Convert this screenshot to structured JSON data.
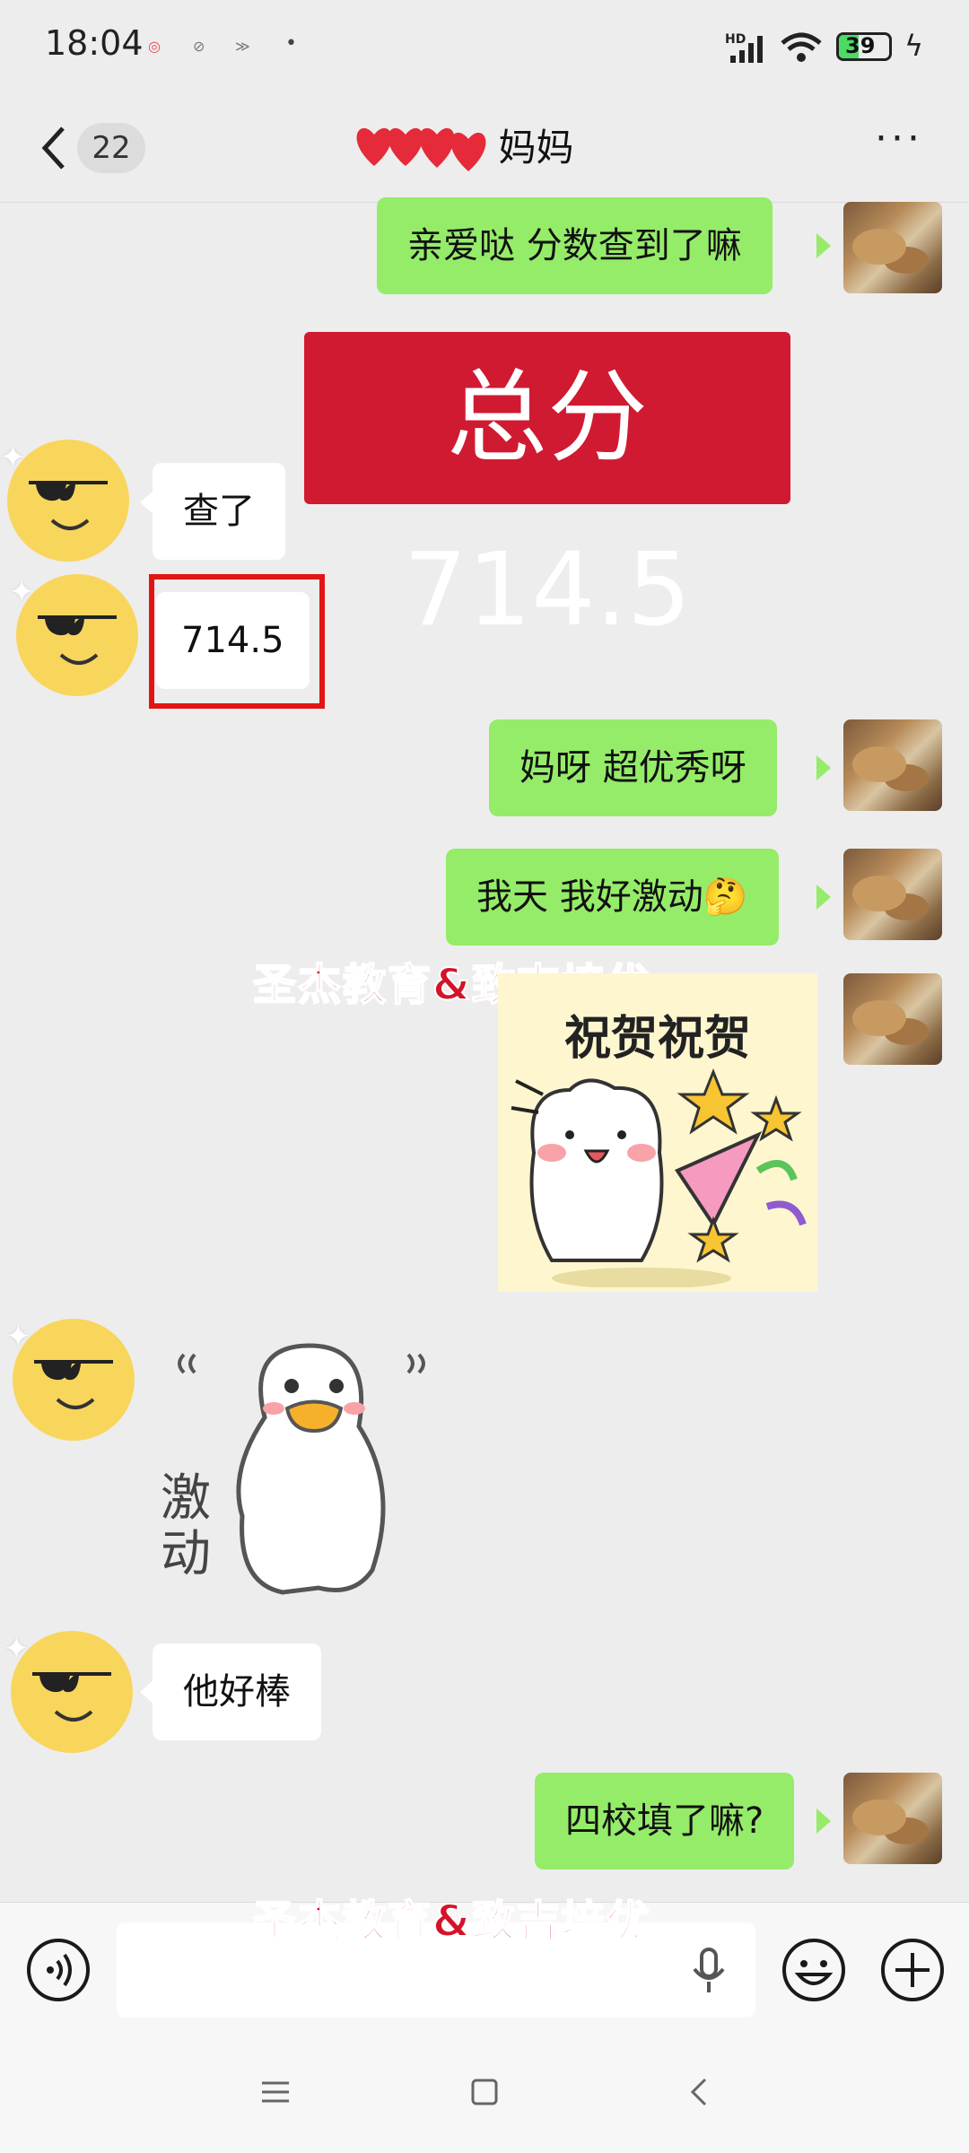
{
  "status": {
    "time": "18:04",
    "network": "HD",
    "battery": "39"
  },
  "header": {
    "back_count": "22",
    "title": "妈妈",
    "more": "···"
  },
  "messages": {
    "m1": "亲爱哒 分数查到了嘛",
    "score_card": "总分714.5",
    "m2": "查了",
    "m3": "714.5",
    "m4": "妈呀  超优秀呀",
    "m5": "我天 我好激动🤔",
    "sticker1_text": "祝贺祝贺",
    "sticker2_text": "激动",
    "m6": "他好棒",
    "m7": "四校填了嘛?"
  },
  "watermark": {
    "text": "圣杰教育&致吉培优"
  },
  "icons": {
    "voice": "voice-icon",
    "mic": "mic-icon",
    "emoji": "emoji-icon",
    "add": "add-icon",
    "back": "chevron-left-icon"
  }
}
